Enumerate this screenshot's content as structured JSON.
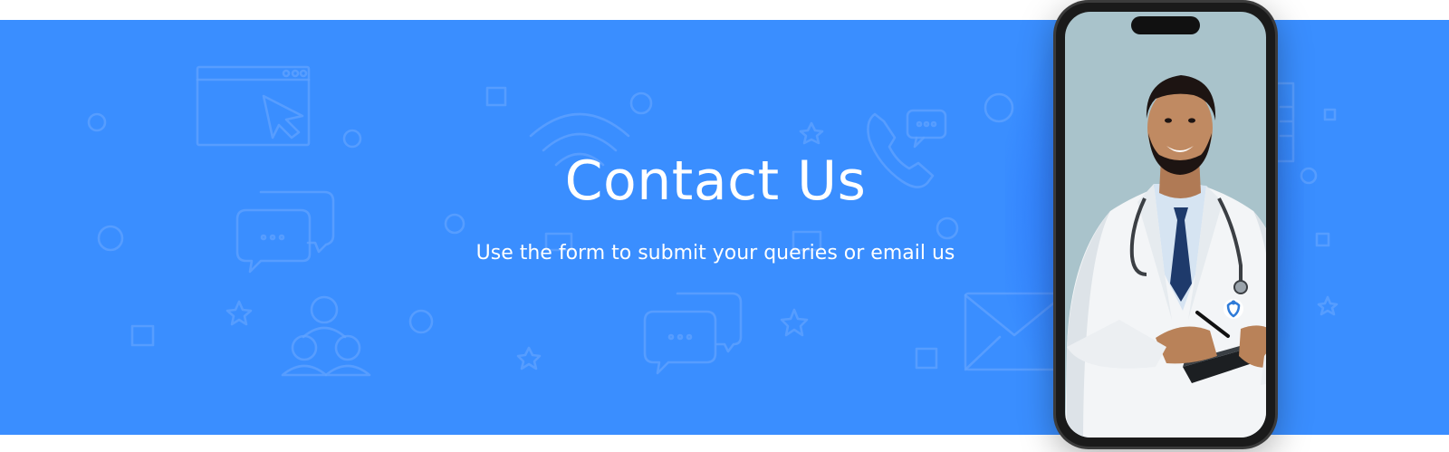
{
  "hero": {
    "title": "Contact Us",
    "subtitle": "Use the form to submit your queries or email us"
  },
  "colors": {
    "banner_background": "#3a8eff",
    "pattern_stroke": "#6eaaff",
    "text": "#ffffff",
    "phone_frame": "#1a1a1a",
    "screen_background": "#a9c3cb"
  },
  "decorations": {
    "background_icons": [
      "browser-window-cursor-icon",
      "wifi-icon",
      "phone-call-icon",
      "chat-bubbles-icon",
      "user-group-icon",
      "envelope-icon",
      "star-icon",
      "circle-shape",
      "square-shape",
      "clipboard-icon"
    ],
    "phone_image": "doctor-with-stethoscope-and-clipboard"
  }
}
